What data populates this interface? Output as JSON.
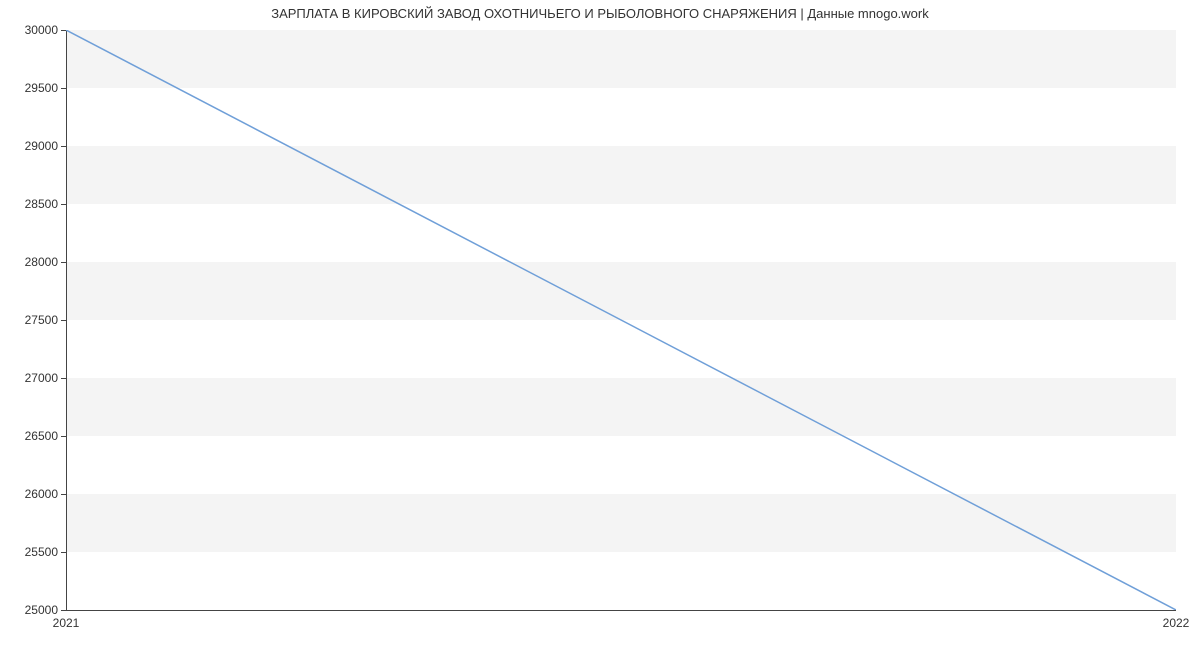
{
  "chart_data": {
    "type": "line",
    "title": "ЗАРПЛАТА В  КИРОВСКИЙ ЗАВОД ОХОТНИЧЬЕГО И РЫБОЛОВНОГО СНАРЯЖЕНИЯ | Данные mnogo.work",
    "x": [
      2021,
      2022
    ],
    "values": [
      30000,
      25000
    ],
    "xlabel": "",
    "ylabel": "",
    "x_ticks": [
      "2021",
      "2022"
    ],
    "y_ticks": [
      "25000",
      "25500",
      "26000",
      "26500",
      "27000",
      "27500",
      "28000",
      "28500",
      "29000",
      "29500",
      "30000"
    ],
    "xlim": [
      2021,
      2022
    ],
    "ylim": [
      25000,
      30000
    ],
    "line_color": "#6f9fd8",
    "band_color": "#f4f4f4"
  }
}
